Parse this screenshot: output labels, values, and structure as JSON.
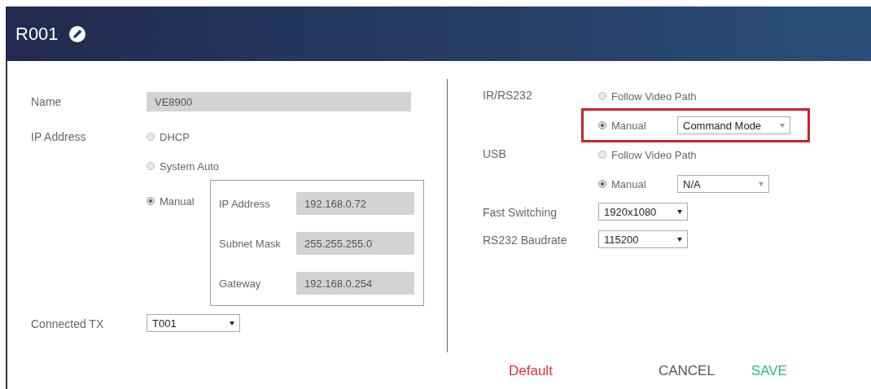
{
  "title": "R001",
  "left": {
    "name": {
      "label": "Name",
      "value": "VE8900"
    },
    "ip_address": {
      "label": "IP Address",
      "options": [
        {
          "label": "DHCP",
          "selected": false
        },
        {
          "label": "System Auto",
          "selected": false
        },
        {
          "label": "Manual",
          "selected": true
        }
      ],
      "manual_fields": [
        {
          "label": "IP Address",
          "value": "192.168.0.72"
        },
        {
          "label": "Subnet Mask",
          "value": "255.255.255.0"
        },
        {
          "label": "Gateway",
          "value": "192.168.0.254"
        }
      ]
    },
    "connected_tx": {
      "label": "Connected TX",
      "value": "T001"
    }
  },
  "right": {
    "groups": [
      {
        "label": "IR/RS232",
        "options": [
          {
            "label": "Follow Video Path",
            "selected": false,
            "highlighted": false
          },
          {
            "label": "Manual",
            "selected": true,
            "highlighted": true,
            "dropdown": "Command Mode"
          }
        ]
      },
      {
        "label": "USB",
        "options": [
          {
            "label": "Follow Video Path",
            "selected": false,
            "highlighted": false
          },
          {
            "label": "Manual",
            "selected": true,
            "highlighted": false,
            "dropdown": "N/A"
          }
        ]
      }
    ],
    "selects": [
      {
        "label": "Fast Switching",
        "value": "1920x1080"
      },
      {
        "label": "RS232 Baudrate",
        "value": "115200"
      }
    ]
  },
  "buttons": [
    {
      "label": "Default",
      "kind": "default"
    },
    {
      "label": "CANCEL",
      "kind": "cancel"
    },
    {
      "label": "SAVE",
      "kind": "save"
    }
  ]
}
